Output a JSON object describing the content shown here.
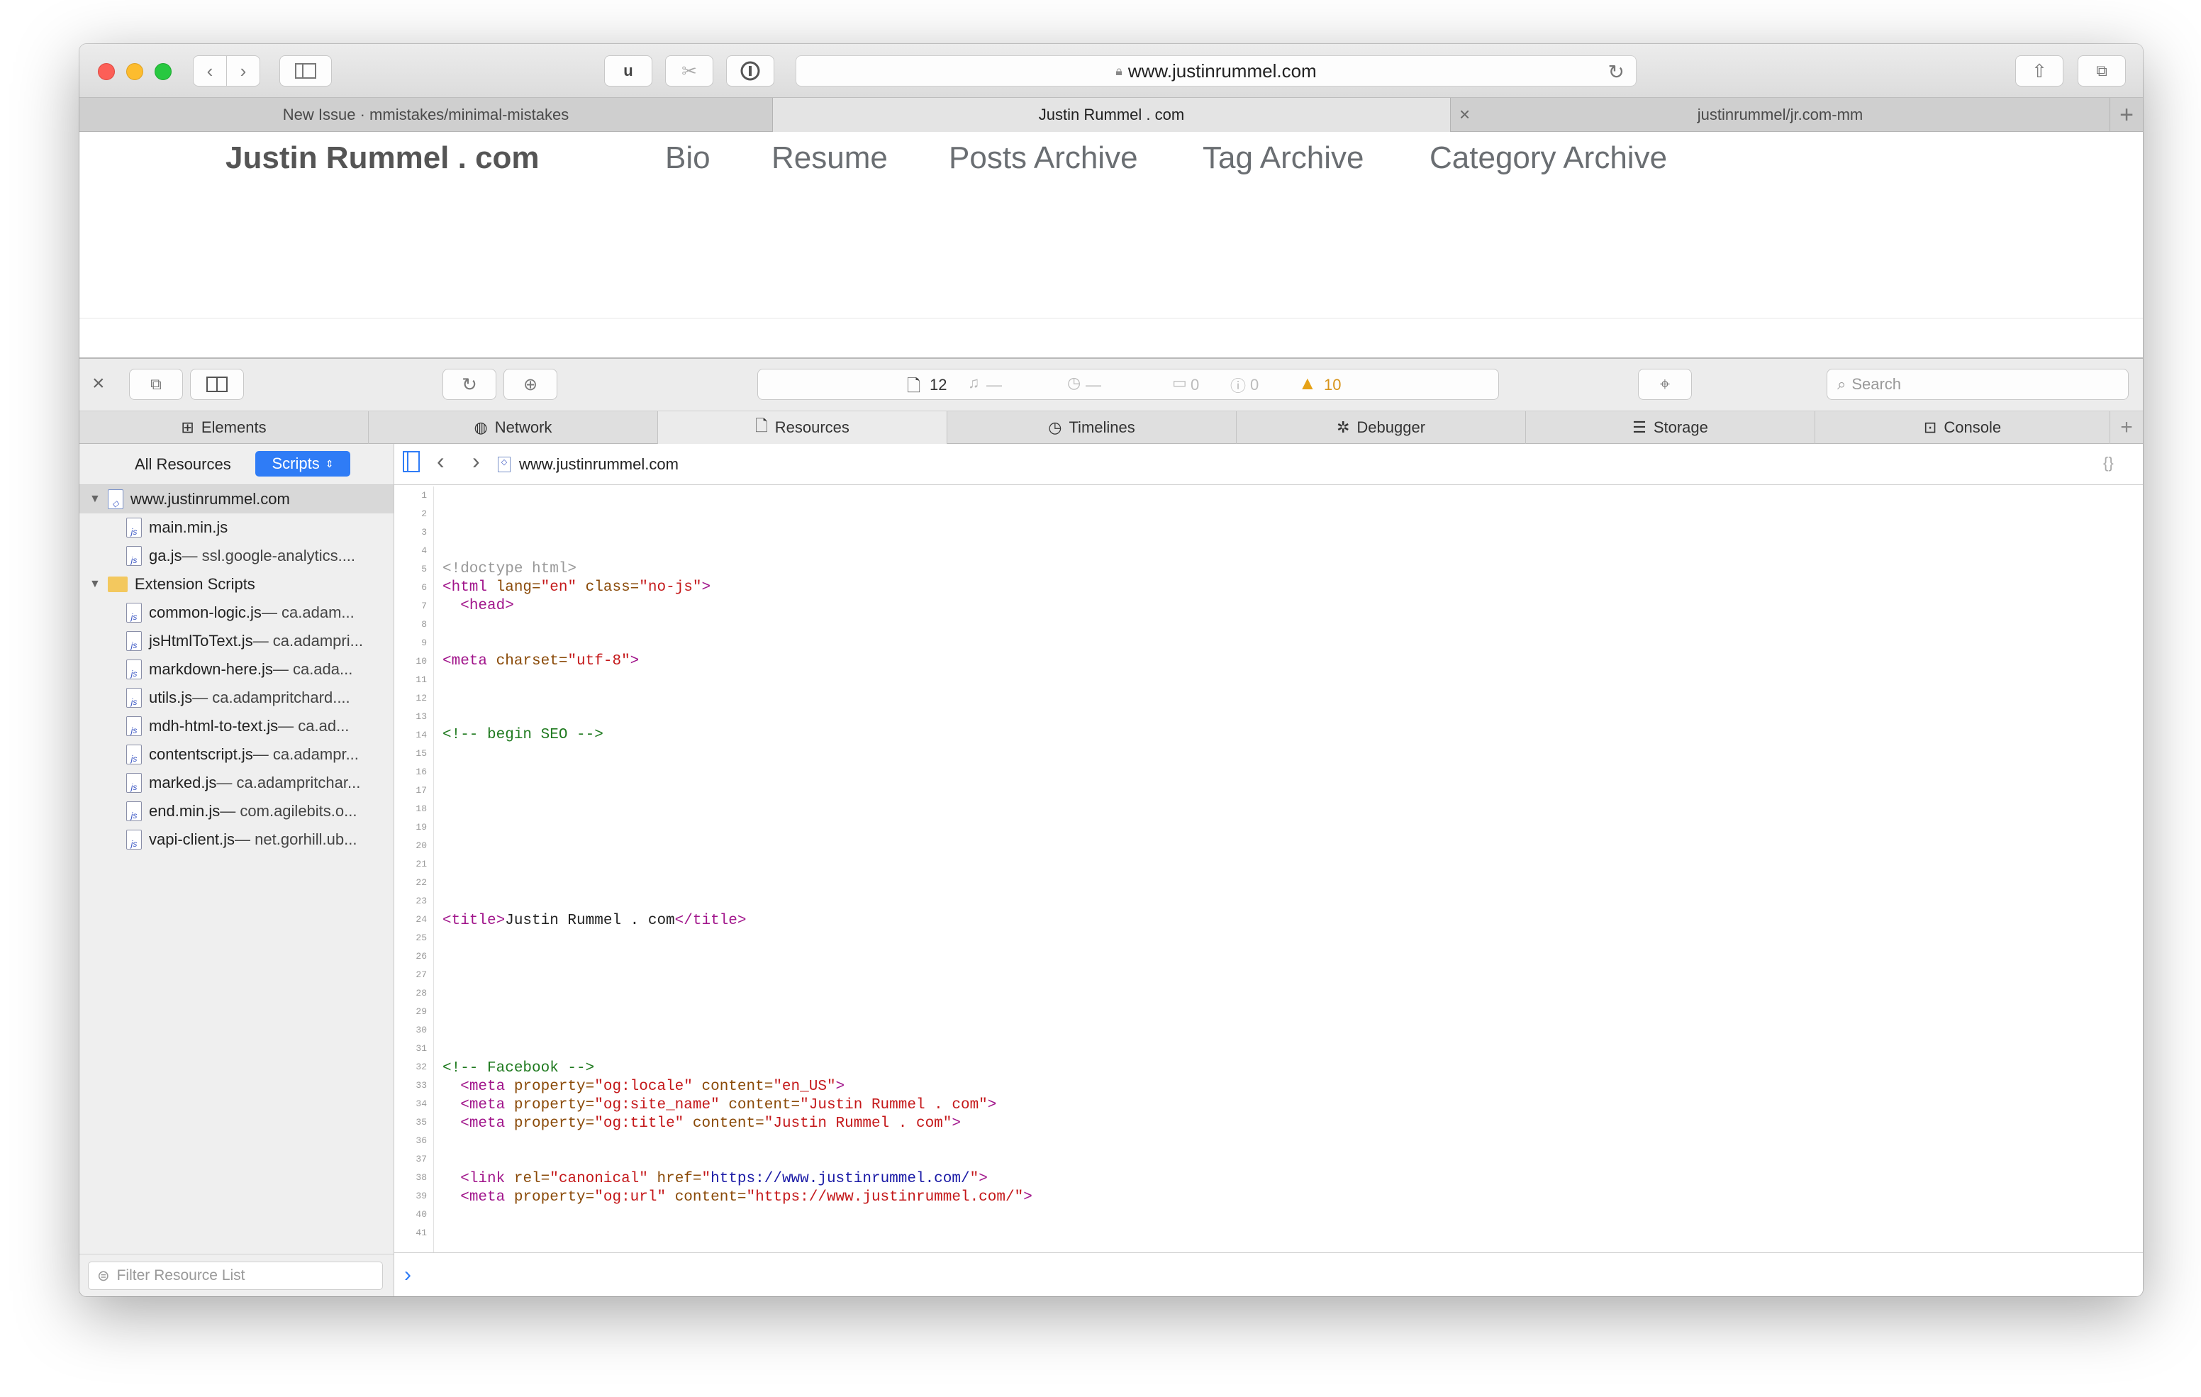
{
  "browser": {
    "url": "www.justinrummel.com",
    "toolbar_icons": [
      "back-icon",
      "forward-icon",
      "sidebar-icon",
      "reader-u-icon",
      "extension-icon",
      "onepassword-icon",
      "reload-icon",
      "share-icon",
      "tabs-overview-icon"
    ]
  },
  "tabs": [
    {
      "label": "New Issue · mmistakes/minimal-mistakes"
    },
    {
      "label": "Justin Rummel . com"
    },
    {
      "label": "justinrummel/jr.com-mm"
    }
  ],
  "site": {
    "title": "Justin Rummel . com",
    "nav": [
      "Bio",
      "Resume",
      "Posts Archive",
      "Tag Archive",
      "Category Archive"
    ]
  },
  "devtools": {
    "status": {
      "resources": "12",
      "errors": "0",
      "logs": "0",
      "warnings": "10",
      "dash1": "—",
      "dash2": "—"
    },
    "search_placeholder": "Search",
    "tabs": [
      "Elements",
      "Network",
      "Resources",
      "Timelines",
      "Debugger",
      "Storage",
      "Console"
    ],
    "sidebar": {
      "all_resources": "All Resources",
      "scripts_label": "Scripts",
      "root": "www.justinrummel.com",
      "root_files": [
        {
          "name": "main.min.js",
          "sub": ""
        },
        {
          "name": "ga.js",
          "sub": " — ssl.google-analytics...."
        }
      ],
      "ext_folder": "Extension Scripts",
      "ext_files": [
        {
          "name": "common-logic.js",
          "sub": " — ca.adam..."
        },
        {
          "name": "jsHtmlToText.js",
          "sub": " — ca.adampri..."
        },
        {
          "name": "markdown-here.js",
          "sub": " — ca.ada..."
        },
        {
          "name": "utils.js",
          "sub": " — ca.adampritchard...."
        },
        {
          "name": "mdh-html-to-text.js",
          "sub": " — ca.ad..."
        },
        {
          "name": "contentscript.js",
          "sub": " — ca.adampr..."
        },
        {
          "name": "marked.js",
          "sub": " — ca.adampritchar..."
        },
        {
          "name": "end.min.js",
          "sub": " — com.agilebits.o..."
        },
        {
          "name": "vapi-client.js",
          "sub": " — net.gorhill.ub..."
        }
      ],
      "filter_placeholder": "Filter Resource List"
    },
    "editor": {
      "path": "www.justinrummel.com",
      "line_count": 41,
      "console_prompt": "›"
    }
  }
}
